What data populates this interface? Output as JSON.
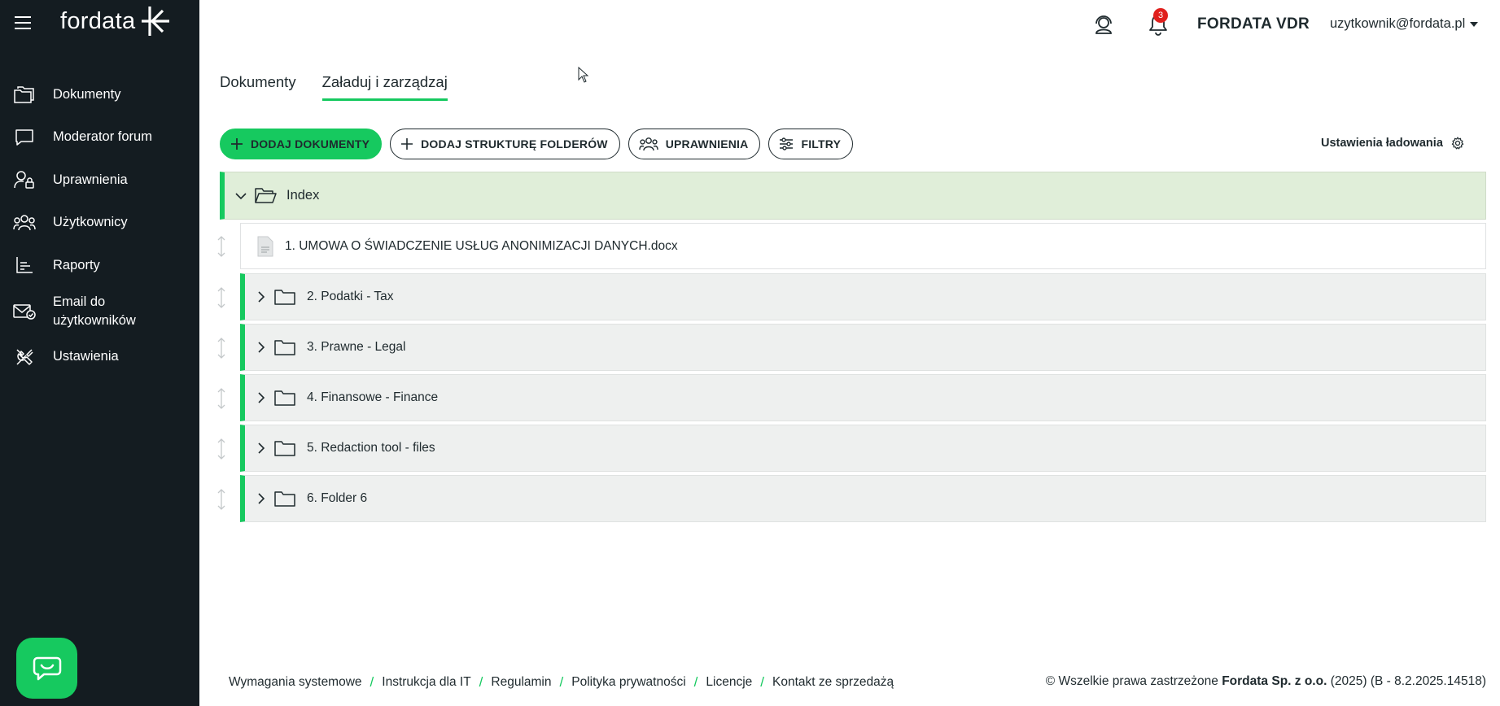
{
  "app": {
    "logo_text": "fordata",
    "brand_color": "#16c95f",
    "sidebar_bg": "#141c21"
  },
  "sidebar": {
    "items": [
      {
        "label": "Dokumenty",
        "icon": "documents-icon"
      },
      {
        "label": "Moderator forum",
        "icon": "chat-bubble-icon"
      },
      {
        "label": "Uprawnienia",
        "icon": "user-lock-icon"
      },
      {
        "label": "Użytkownicy",
        "icon": "users-icon"
      },
      {
        "label": "Raporty",
        "icon": "chart-icon"
      },
      {
        "label": "Email do użytkowników",
        "icon": "mail-check-icon"
      },
      {
        "label": "Ustawienia",
        "icon": "tools-icon"
      }
    ],
    "chat_icon": "chat-support-icon"
  },
  "header": {
    "notifications_count": "3",
    "vdr_label": "FORDATA VDR",
    "user_email": "uzytkownik@fordata.pl"
  },
  "tabs": [
    {
      "label": "Dokumenty",
      "active": false
    },
    {
      "label": "Załaduj i zarządzaj",
      "active": true
    }
  ],
  "toolbar": {
    "add_documents": "DODAJ DOKUMENTY",
    "add_folder_structure": "DODAJ STRUKTURĘ FOLDERÓW",
    "permissions": "UPRAWNIENIA",
    "filters": "FILTRY",
    "upload_settings": "Ustawienia ładowania"
  },
  "tree": {
    "root": {
      "label": "Index",
      "expanded": true
    },
    "file": {
      "label": "1. UMOWA O ŚWIADCZENIE USŁUG ANONIMIZACJI DANYCH.docx"
    },
    "folders": [
      {
        "label": "2. Podatki - Tax"
      },
      {
        "label": "3. Prawne - Legal"
      },
      {
        "label": "4. Finansowe - Finance"
      },
      {
        "label": "5. Redaction tool - files"
      },
      {
        "label": "6. Folder 6"
      }
    ]
  },
  "footer": {
    "links": [
      "Wymagania systemowe",
      "Instrukcja dla IT",
      "Regulamin",
      "Polityka prywatności",
      "Licencje",
      "Kontakt ze sprzedażą"
    ],
    "copyright_prefix": "© Wszelkie prawa zastrzeżone",
    "company": "Fordata Sp. z o.o.",
    "copyright_suffix": "(2025) (B - 8.2.2025.14518)"
  }
}
